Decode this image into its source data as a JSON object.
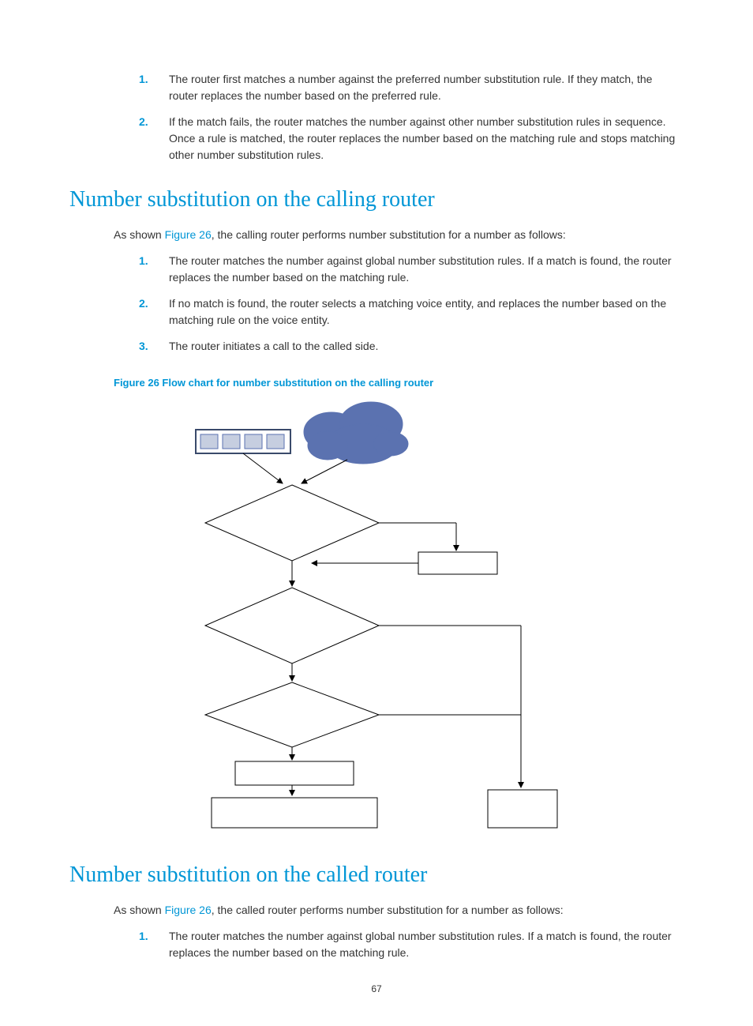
{
  "top_list": [
    "The router first matches a number against the preferred number substitution rule. If they match, the router replaces the number based on the preferred rule.",
    "If the match fails, the router matches the number against other number substitution rules in sequence. Once a rule is matched, the router replaces the number based on the matching rule and stops matching other number substitution rules."
  ],
  "section1": {
    "title": "Number substitution on the calling router",
    "intro_prefix": "As shown ",
    "intro_link": "Figure 26",
    "intro_suffix": ", the calling router performs number substitution for a number as follows:",
    "steps": [
      "The router matches the number against global number substitution rules. If a match is found, the router replaces the number based on the matching rule.",
      "If no match is found, the router selects a matching voice entity, and replaces the number based on the matching rule on the voice entity.",
      "The router initiates a call to the called side."
    ],
    "figure_caption": "Figure 26 Flow chart for number substitution on the calling router"
  },
  "section2": {
    "title": "Number substitution on the called router",
    "intro_prefix": "As shown ",
    "intro_link": "Figure 26",
    "intro_suffix": ", the called router performs number substitution for a number as follows:",
    "steps": [
      "The router matches the number against global number substitution rules. If a match is found, the router replaces the number based on the matching rule."
    ]
  },
  "page_number": "67"
}
